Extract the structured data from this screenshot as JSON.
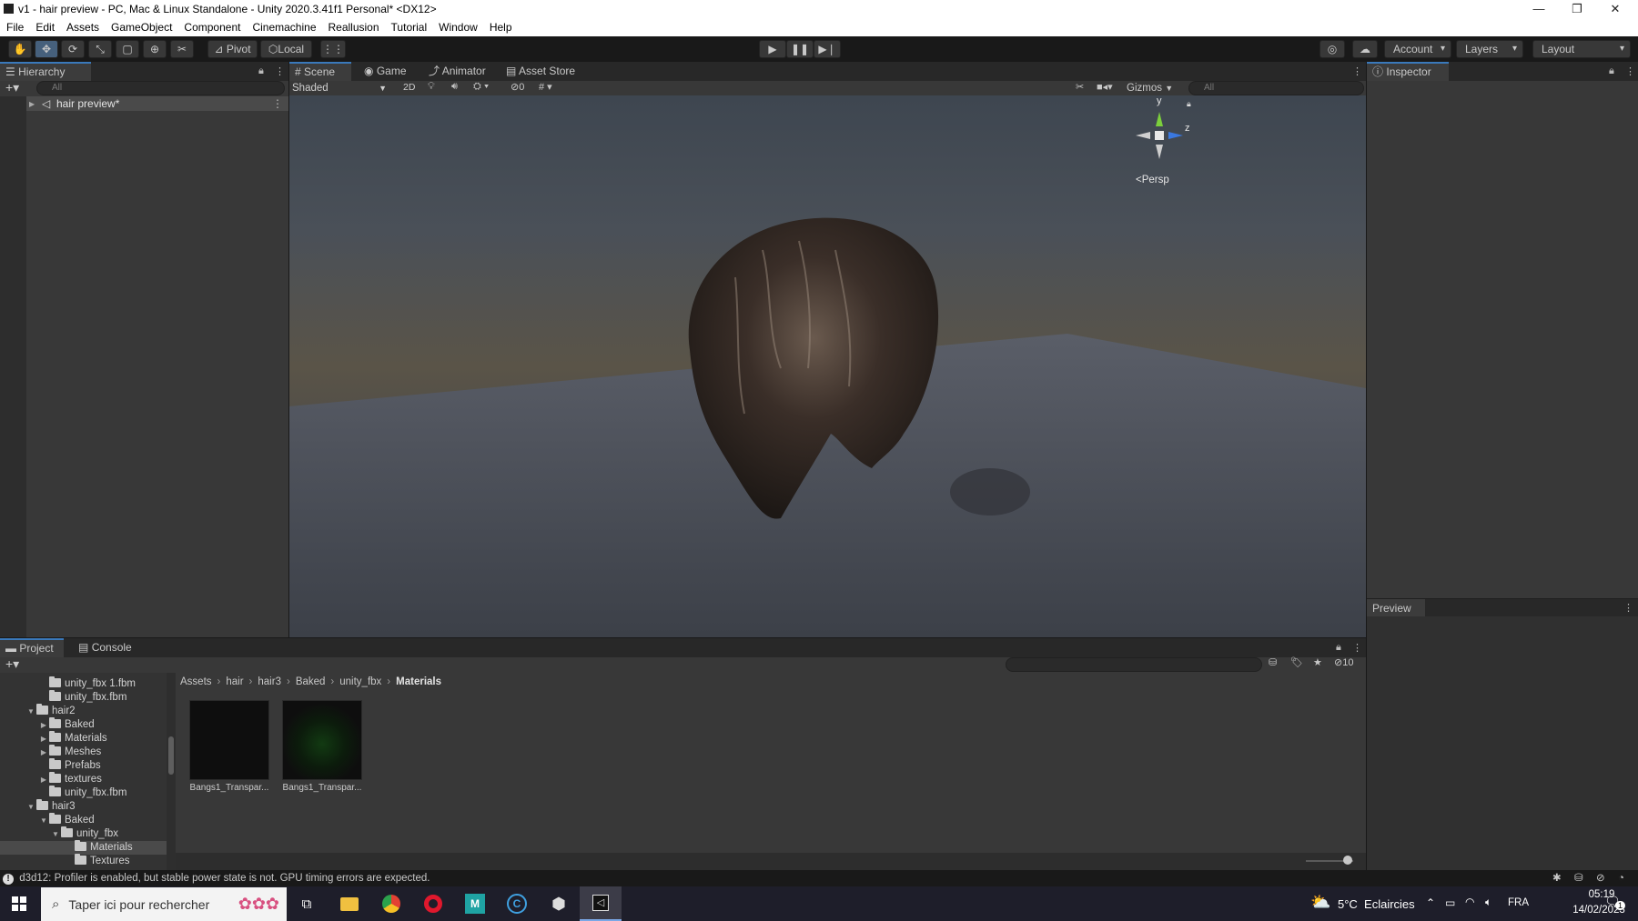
{
  "window": {
    "title": "v1 - hair preview - PC, Mac & Linux Standalone - Unity 2020.3.41f1 Personal* <DX12>",
    "minimize": "—",
    "restore": "❐",
    "close": "✕"
  },
  "menu": [
    "File",
    "Edit",
    "Assets",
    "GameObject",
    "Component",
    "Cinemachine",
    "Reallusion",
    "Tutorial",
    "Window",
    "Help"
  ],
  "toolbar": {
    "pivot_label": "Pivot",
    "local_label": "Local",
    "account_label": "Account",
    "layers_label": "Layers",
    "layout_label": "Layout"
  },
  "hierarchy": {
    "tab_label": "Hierarchy",
    "search_placeholder": "All",
    "scene_item": "hair preview*"
  },
  "scene": {
    "tabs": [
      "Scene",
      "Game",
      "Animator",
      "Asset Store"
    ],
    "shading_mode": "Shaded",
    "mode_2d": "2D",
    "hidden_count": "0",
    "gizmos_label": "Gizmos",
    "search_placeholder": "All",
    "axis_y": "y",
    "axis_z": "z",
    "projection": "Persp"
  },
  "inspector": {
    "tab_label": "Inspector",
    "preview_label": "Preview"
  },
  "project": {
    "tabs": [
      "Project",
      "Console"
    ],
    "hidden_count": "10",
    "tree": [
      {
        "label": "unity_fbx 1.fbm",
        "depth": 3,
        "arrow": ""
      },
      {
        "label": "unity_fbx.fbm",
        "depth": 3,
        "arrow": ""
      },
      {
        "label": "hair2",
        "depth": 1,
        "arrow": "▼"
      },
      {
        "label": "Baked",
        "depth": 2,
        "arrow": "▶"
      },
      {
        "label": "Materials",
        "depth": 2,
        "arrow": "▶"
      },
      {
        "label": "Meshes",
        "depth": 2,
        "arrow": "▶"
      },
      {
        "label": "Prefabs",
        "depth": 2,
        "arrow": ""
      },
      {
        "label": "textures",
        "depth": 2,
        "arrow": "▶"
      },
      {
        "label": "unity_fbx.fbm",
        "depth": 2,
        "arrow": ""
      },
      {
        "label": "hair3",
        "depth": 1,
        "arrow": "▼"
      },
      {
        "label": "Baked",
        "depth": 2,
        "arrow": "▼"
      },
      {
        "label": "unity_fbx",
        "depth": 3,
        "arrow": "▼"
      },
      {
        "label": "Materials",
        "depth": 4,
        "arrow": ""
      },
      {
        "label": "Textures",
        "depth": 4,
        "arrow": ""
      }
    ],
    "breadcrumb": [
      "Assets",
      "hair",
      "hair3",
      "Baked",
      "unity_fbx",
      "Materials"
    ],
    "assets": [
      {
        "label": "Bangs1_Transpar..."
      },
      {
        "label": "Bangs1_Transpar..."
      }
    ]
  },
  "status": {
    "message": "d3d12: Profiler is enabled, but stable power state is not. GPU timing errors are expected."
  },
  "taskbar": {
    "search_placeholder": "Taper ici pour rechercher",
    "weather": "5°C  Eclaircies",
    "language": "FRA",
    "time": "05:19",
    "date": "14/02/2023",
    "notification_count": "1"
  },
  "colors": {
    "accent": "#3a79bb",
    "panel": "#383838",
    "toolbar": "#191919"
  }
}
